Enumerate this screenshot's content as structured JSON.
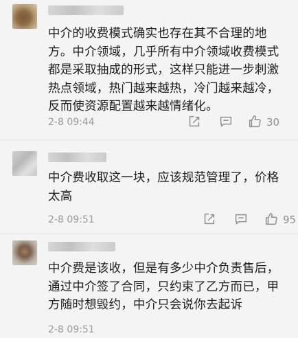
{
  "comments": [
    {
      "text": "中介的收费模式确实也存在其不合理的地方。中介领域，几乎所有中介领域收费模式都是采取抽成的形式，这样只能进一步刺激热点领域，热门越来越热，冷门越来越冷，反而使资源配置越来越情绪化。",
      "time": "2-8 09:44",
      "likes": "30",
      "icons": [
        "share-icon",
        "comment-icon",
        "like-icon"
      ]
    },
    {
      "text": "中介费收取这一块，应该规范管理了，价格太高",
      "time": "2-8 09:51",
      "likes": "95",
      "icons": [
        "share-icon",
        "comment-icon",
        "like-icon"
      ]
    },
    {
      "text": "中介费是该收，但是有多少中介负责售后，通过中介签了合同，只约束了乙方而已，甲方随时想毁约，中介只会说你去起诉",
      "time": "2-8 09:51",
      "likes": "",
      "icons": [
        "share-icon",
        "comment-icon",
        "like-icon"
      ]
    }
  ]
}
